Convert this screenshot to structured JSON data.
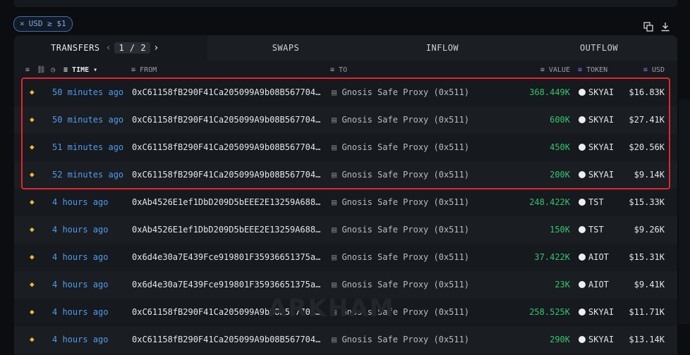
{
  "filter": {
    "label": "USD ≥ $1",
    "close": "×"
  },
  "tabs": [
    {
      "label": "TRANSFERS",
      "page": "1 / 2"
    },
    {
      "label": "SWAPS"
    },
    {
      "label": "INFLOW"
    },
    {
      "label": "OUTFLOW"
    }
  ],
  "columns": {
    "time": "TIME",
    "from": "FROM",
    "to": "TO",
    "value": "VALUE",
    "token": "TOKEN",
    "usd": "USD"
  },
  "rows": [
    {
      "time": "50 minutes ago",
      "from": "0xC61158fB290F41Ca205099A9b08B567704…",
      "to": "Gnosis Safe Proxy (0x511)",
      "value": "368.449K",
      "token": "SKYAI",
      "usd": "$16.83K"
    },
    {
      "time": "50 minutes ago",
      "from": "0xC61158fB290F41Ca205099A9b08B567704…",
      "to": "Gnosis Safe Proxy (0x511)",
      "value": "600K",
      "token": "SKYAI",
      "usd": "$27.41K"
    },
    {
      "time": "51 minutes ago",
      "from": "0xC61158fB290F41Ca205099A9b08B567704…",
      "to": "Gnosis Safe Proxy (0x511)",
      "value": "450K",
      "token": "SKYAI",
      "usd": "$20.56K"
    },
    {
      "time": "52 minutes ago",
      "from": "0xC61158fB290F41Ca205099A9b08B567704…",
      "to": "Gnosis Safe Proxy (0x511)",
      "value": "200K",
      "token": "SKYAI",
      "usd": "$9.14K"
    },
    {
      "time": "4 hours ago",
      "from": "0xAb4526E1ef1DbD209D5bEEE2E13259A688…",
      "to": "Gnosis Safe Proxy (0x511)",
      "value": "248.422K",
      "token": "TST",
      "usd": "$15.33K"
    },
    {
      "time": "4 hours ago",
      "from": "0xAb4526E1ef1DbD209D5bEEE2E13259A688…",
      "to": "Gnosis Safe Proxy (0x511)",
      "value": "150K",
      "token": "TST",
      "usd": "$9.26K"
    },
    {
      "time": "4 hours ago",
      "from": "0x6d4e30a7E439Fce919801F35936651375a…",
      "to": "Gnosis Safe Proxy (0x511)",
      "value": "37.422K",
      "token": "AIOT",
      "usd": "$15.31K"
    },
    {
      "time": "4 hours ago",
      "from": "0x6d4e30a7E439Fce919801F35936651375a…",
      "to": "Gnosis Safe Proxy (0x511)",
      "value": "23K",
      "token": "AIOT",
      "usd": "$9.41K"
    },
    {
      "time": "4 hours ago",
      "from": "0xC61158fB290F41Ca205099A9b08B567704…",
      "to": "Gnosis Safe Proxy (0x511)",
      "value": "258.525K",
      "token": "SKYAI",
      "usd": "$11.71K"
    },
    {
      "time": "4 hours ago",
      "from": "0xC61158fB290F41Ca205099A9b08B567704…",
      "to": "Gnosis Safe Proxy (0x511)",
      "value": "290K",
      "token": "SKYAI",
      "usd": "$13.14K"
    }
  ],
  "watermark": "ARKHAM"
}
